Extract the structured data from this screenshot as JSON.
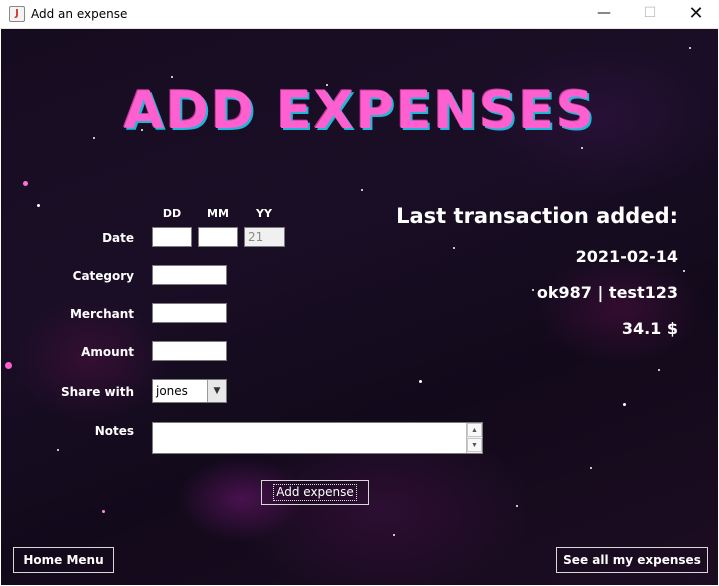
{
  "window": {
    "title": "Add an expense",
    "minimize_glyph": "—",
    "maximize_glyph": "☐",
    "close_glyph": "✕"
  },
  "header": {
    "title": "ADD EXPENSES"
  },
  "form": {
    "date_columns": {
      "day": "DD",
      "month": "MM",
      "year": "YY"
    },
    "labels": {
      "date": "Date",
      "category": "Category",
      "merchant": "Merchant",
      "amount": "Amount",
      "share_with": "Share with",
      "notes": "Notes"
    },
    "values": {
      "day": "",
      "month": "",
      "year": "21",
      "category": "",
      "merchant": "",
      "amount": "",
      "share_with": "jones",
      "notes": ""
    },
    "submit_label": "Add expense"
  },
  "last_transaction": {
    "title": "Last transaction added:",
    "date": "2021-02-14",
    "parties": "ok987 | test123",
    "amount": "34.1 $"
  },
  "footer": {
    "home_label": "Home Menu",
    "see_all_label": "See all my expenses"
  },
  "colors": {
    "title_pink": "#ff5fcf",
    "title_shadow_cyan": "#1fb7d8",
    "background": "#160c1f"
  }
}
